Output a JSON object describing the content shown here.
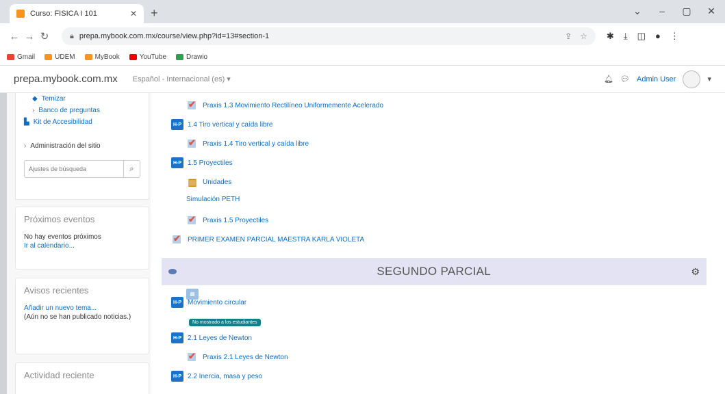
{
  "browser": {
    "tab_title": "Curso: FISICA I 101",
    "url": "prepa.mybook.com.mx/course/view.php?id=13#section-1",
    "bookmarks": [
      "Gmail",
      "UDEM",
      "MyBook",
      "YouTube",
      "Drawio"
    ]
  },
  "navbar": {
    "brand": "prepa.mybook.com.mx",
    "language": "Español - Internacional (es) ▾",
    "user": "Admin User"
  },
  "sidebar": {
    "nav_items": [
      "Temizar",
      "Banco de preguntas",
      "Kit de Accesibilidad"
    ],
    "admin_label": "Administración del sitio",
    "search_placeholder": "Ajustes de búsqueda",
    "events": {
      "title": "Próximos eventos",
      "text": "No hay eventos próximos",
      "link": "Ir al calendario..."
    },
    "news": {
      "title": "Avisos recientes",
      "link": "Añadir un nuevo tema...",
      "text": "(Aún no se han publicado noticias.)"
    },
    "activity": {
      "title": "Actividad reciente"
    }
  },
  "main": {
    "items": [
      "Praxis 1.3 Movimiento Rectilíneo Uniformemente Acelerado",
      "1.4 Tiro vertical y caída libre",
      "Praxis 1.4 Tiro vertical y caída libre",
      "1.5 Proyectiles",
      "Unidades",
      "Simulación PETH",
      "Praxis 1.5 Proyectiles",
      "PRIMER EXAMEN PARCIAL MAESTRA KARLA VIOLETA"
    ],
    "section_title": "SEGUNDO PARCIAL",
    "section2_items": [
      "Movimiento circular",
      "2.1 Leyes de Newton",
      "Praxis 2.1 Leyes de Newton",
      "2.2 Inercia, masa y peso"
    ],
    "hidden_badge": "No mostrado a los estudiantes"
  }
}
